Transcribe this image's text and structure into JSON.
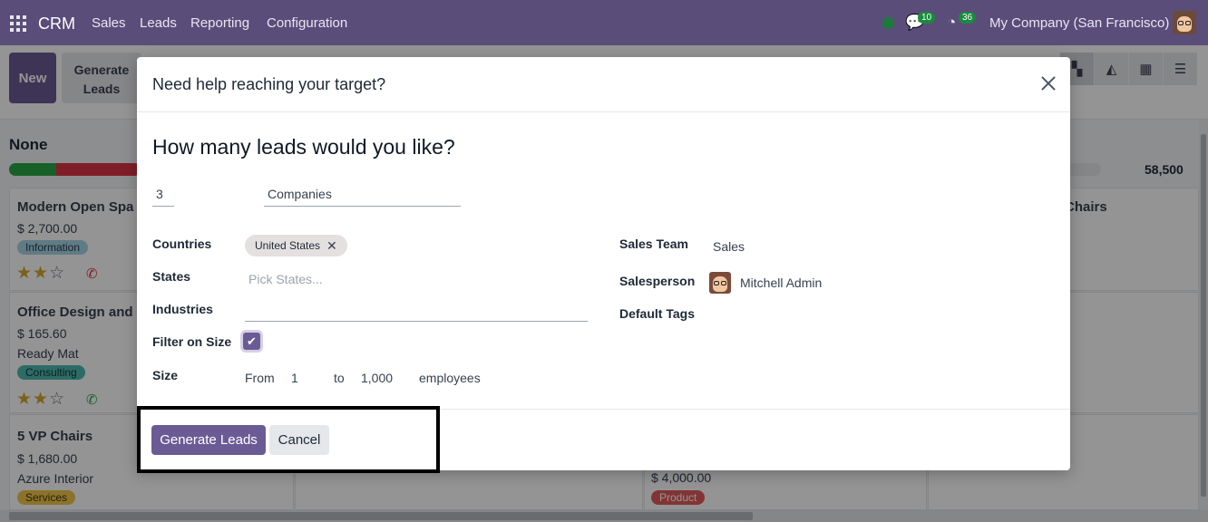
{
  "navbar": {
    "brand": "CRM",
    "menus": [
      "Sales",
      "Leads",
      "Reporting",
      "Configuration"
    ],
    "chat_count": "10",
    "activity_count": "36",
    "company": "My Company (San Francisco)"
  },
  "control_panel": {
    "new_label": "New",
    "generate_line1": "Generate",
    "generate_line2": "Leads"
  },
  "kanban": {
    "column_title": "None",
    "column_total": "58,500",
    "cards": [
      {
        "title": "Modern Open Spa",
        "amount": "$ 2,700.00",
        "tag": "Information"
      },
      {
        "title": "Office Design and",
        "amount": "$ 165.60",
        "customer": "Ready Mat",
        "tag": "Consulting"
      },
      {
        "title": "5 VP Chairs",
        "amount": "$ 1,680.00",
        "customer": "Azure Interior",
        "tag": "Services"
      }
    ],
    "right_card_title": "Chairs",
    "bottom_card_amount": "$ 4,000.00",
    "bottom_card_tag": "Product"
  },
  "dialog": {
    "title": "Need help reaching your target?",
    "heading": "How many leads would you like?",
    "count_value": "3",
    "target_value": "Companies",
    "countries_label": "Countries",
    "country_chip": "United States",
    "states_label": "States",
    "states_placeholder": "Pick States...",
    "industries_label": "Industries",
    "filter_label": "Filter on Size",
    "size_label": "Size",
    "size_from_label": "From",
    "size_from": "1",
    "size_to_label": "to",
    "size_to": "1,000",
    "size_unit": "employees",
    "sales_team_label": "Sales Team",
    "sales_team_value": "Sales",
    "salesperson_label": "Salesperson",
    "salesperson_value": "Mitchell Admin",
    "default_tags_label": "Default Tags",
    "generate_button": "Generate Leads",
    "cancel_button": "Cancel"
  },
  "colors": {
    "navbar": "#5a4d7a",
    "primary": "#6b5b95",
    "tag_information": "#a8d4e6",
    "tag_consulting": "#4fb8b0",
    "tag_services": "#f0c64a",
    "tag_product": "#e05a5a"
  },
  "icons": [
    "apps-grid-icon",
    "chat-icon",
    "activity-clock-icon",
    "kanban-view-icon",
    "graph-view-icon",
    "pivot-view-icon",
    "list-view-icon",
    "phone-icon",
    "star-icon",
    "close-icon",
    "check-icon"
  ]
}
